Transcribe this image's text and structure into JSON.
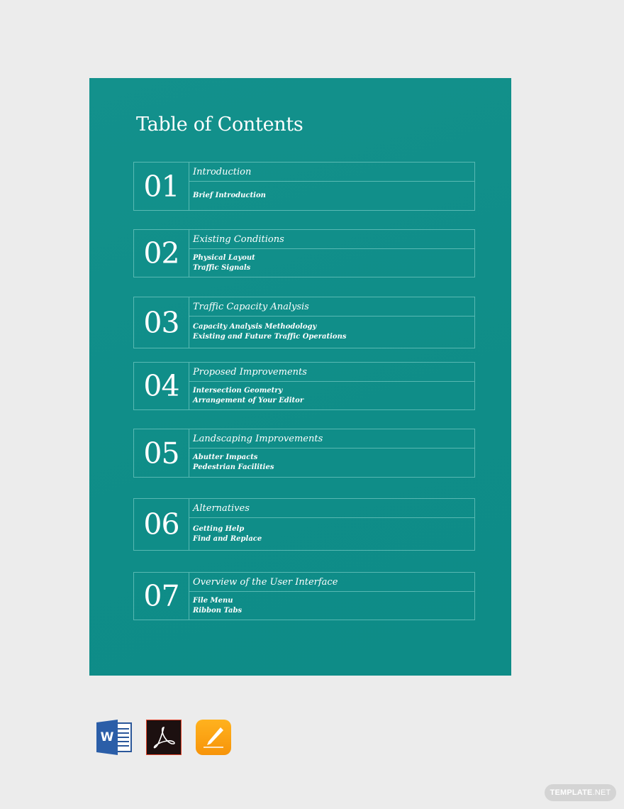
{
  "document": {
    "title": "Table of Contents",
    "background_color": "#128f8a",
    "entries": [
      {
        "number": "01",
        "heading": "Introduction",
        "subitems": [
          "Brief Introduction"
        ]
      },
      {
        "number": "02",
        "heading": "Existing Conditions",
        "subitems": [
          "Physical Layout",
          "Traffic Signals"
        ]
      },
      {
        "number": "03",
        "heading": "Traffic Capacity Analysis",
        "subitems": [
          "Capacity Analysis Methodology",
          "Existing and Future Traffic Operations"
        ]
      },
      {
        "number": "04",
        "heading": "Proposed Improvements",
        "subitems": [
          "Intersection Geometry",
          "Arrangement of Your Editor"
        ]
      },
      {
        "number": "05",
        "heading": "Landscaping Improvements",
        "subitems": [
          "Abutter Impacts",
          "Pedestrian Facilities"
        ]
      },
      {
        "number": "06",
        "heading": "Alternatives",
        "subitems": [
          "Getting Help",
          "Find and Replace"
        ]
      },
      {
        "number": "07",
        "heading": "Overview of the User Interface",
        "subitems": [
          "File Menu",
          "Ribbon Tabs"
        ]
      }
    ]
  },
  "formats": [
    {
      "name": "word-icon",
      "label": "W",
      "color": "#2b5ea8"
    },
    {
      "name": "pdf-icon",
      "color": "#1c1010"
    },
    {
      "name": "pages-icon",
      "color": "#f7940a"
    }
  ],
  "watermark": {
    "bold": "TEMPLATE",
    "rest": ".NET"
  }
}
